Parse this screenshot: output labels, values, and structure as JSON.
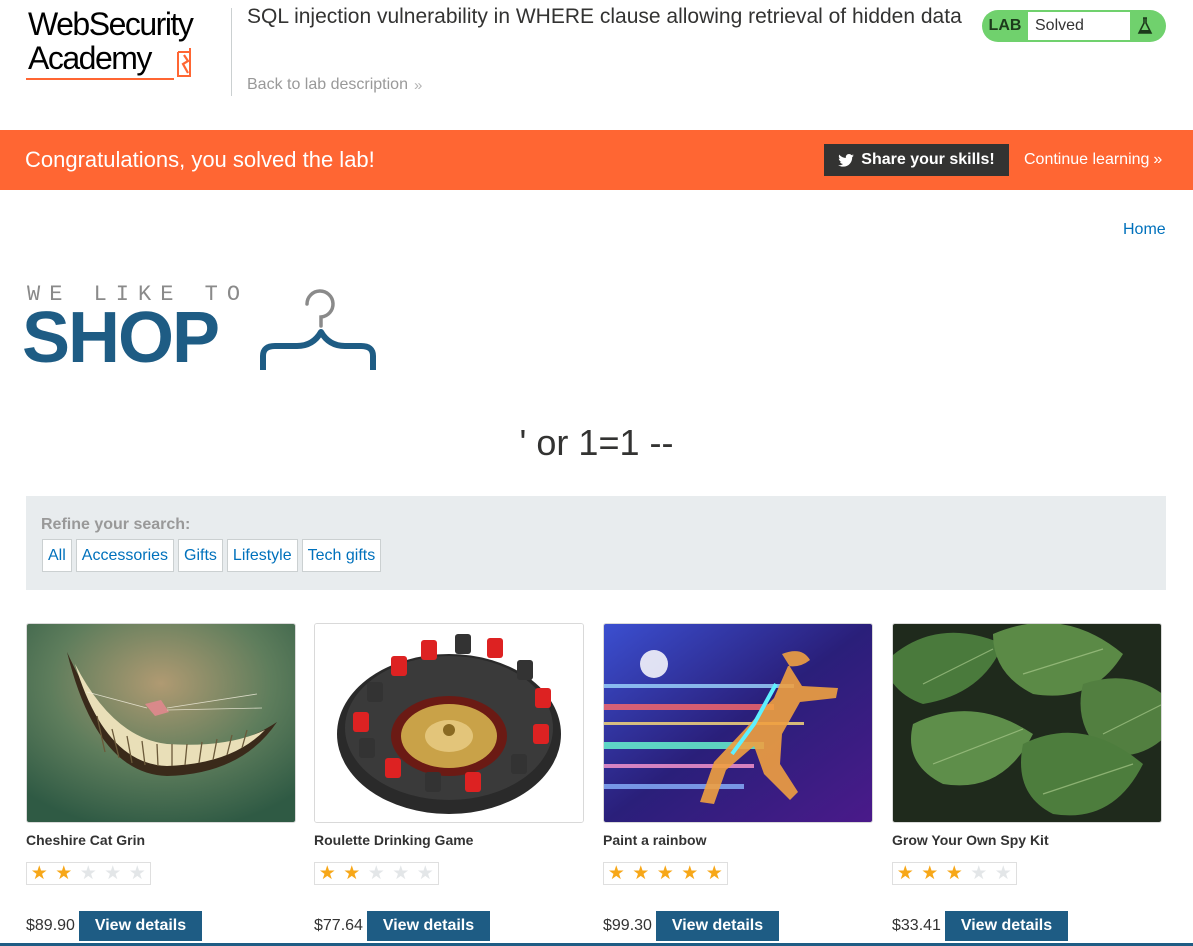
{
  "header": {
    "logo_line1": "WebSecurity",
    "logo_line2": "Academy",
    "lab_title": "SQL injection vulnerability in WHERE clause allowing retrieval of hidden data",
    "back_link": "Back to lab description",
    "lab_badge": "LAB",
    "lab_status": "Solved",
    "status_color": "#70d16d"
  },
  "notification": {
    "message": "Congratulations, you solved the lab!",
    "share_label": "Share your skills!",
    "continue_label": "Continue learning",
    "bar_color": "#ff6633"
  },
  "shop": {
    "home_link": "Home",
    "tagline": "WE LIKE TO",
    "word": "SHOP",
    "search_term": "' or 1=1 --",
    "refine_label": "Refine your search:",
    "filters": [
      "All",
      "Accessories",
      "Gifts",
      "Lifestyle",
      "Tech gifts"
    ],
    "accent_color": "#1e5c84"
  },
  "products": [
    {
      "name": "Cheshire Cat Grin",
      "price": "$89.90",
      "rating": 2,
      "button": "View details",
      "image": "cheshire-grin-image"
    },
    {
      "name": "Roulette Drinking Game",
      "price": "$77.64",
      "rating": 2,
      "button": "View details",
      "image": "roulette-wheel-image"
    },
    {
      "name": "Paint a rainbow",
      "price": "$99.30",
      "rating": 5,
      "button": "View details",
      "image": "neon-runner-image"
    },
    {
      "name": "Grow Your Own Spy Kit",
      "price": "$33.41",
      "rating": 3,
      "button": "View details",
      "image": "green-leaves-image"
    }
  ]
}
